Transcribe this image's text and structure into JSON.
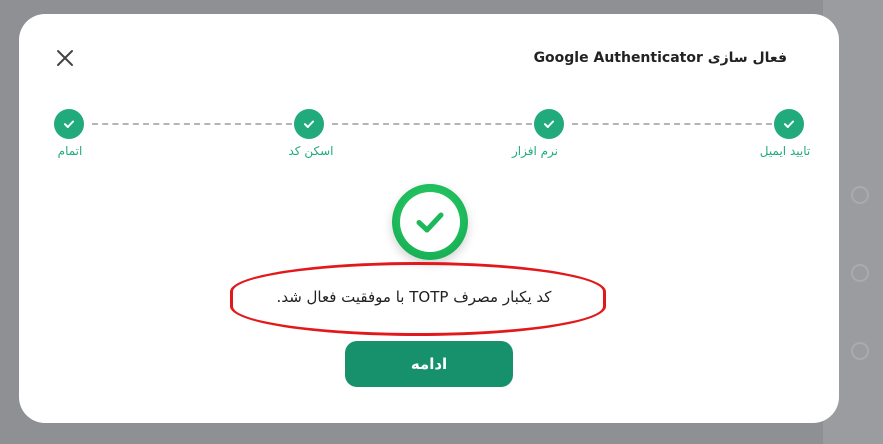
{
  "modal": {
    "title": "فعال سازی Google Authenticator"
  },
  "stepper": {
    "steps": [
      {
        "label": "تایید ایمیل",
        "status": "complete"
      },
      {
        "label": "نرم افزار",
        "status": "complete"
      },
      {
        "label": "اسکن کد",
        "status": "complete"
      },
      {
        "label": "اتمام",
        "status": "complete"
      }
    ],
    "active_color": "#21ab7d"
  },
  "result": {
    "message": "کد یکبار مصرف TOTP با موفقیت فعال شد.",
    "icon": "check-circle-icon"
  },
  "actions": {
    "continue_label": "ادامه"
  },
  "colors": {
    "primary": "#17916c",
    "success": "#1cb85a",
    "highlight": "#e3181b"
  }
}
